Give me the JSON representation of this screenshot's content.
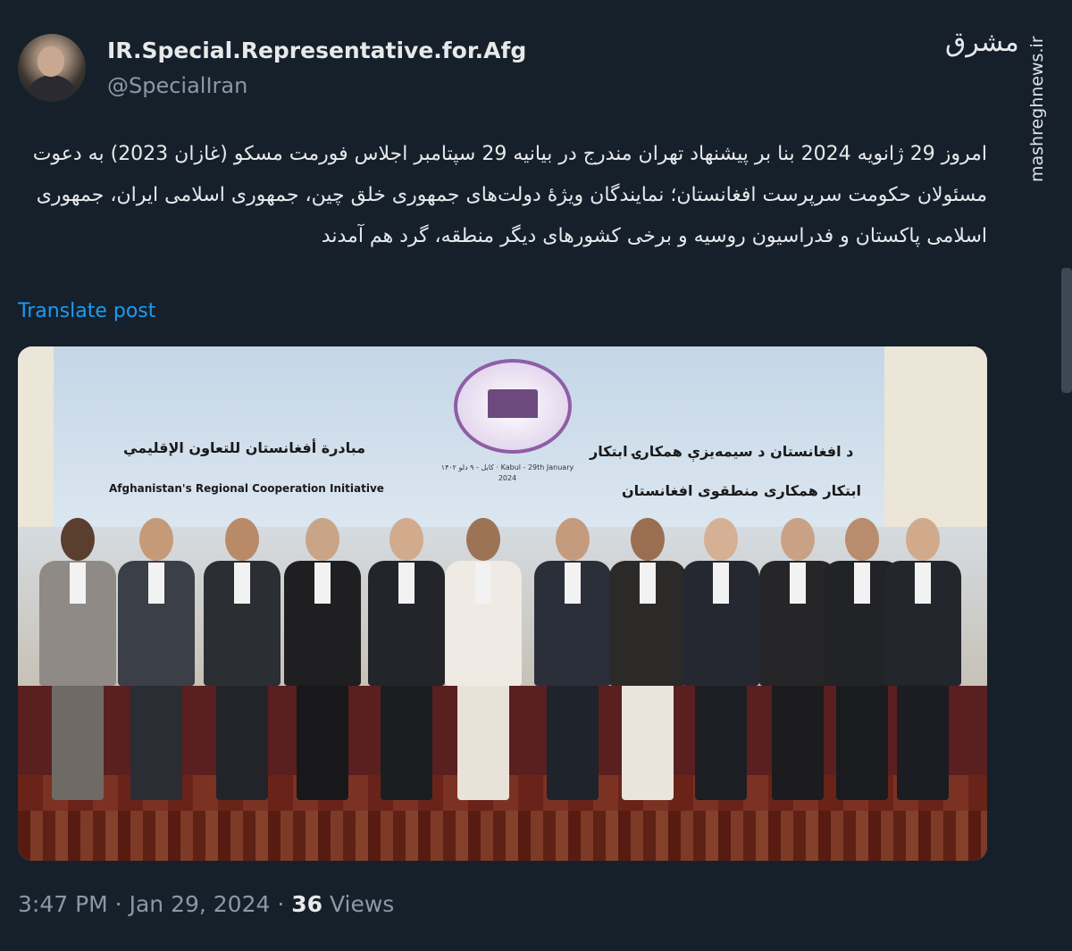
{
  "author": {
    "display_name": "IR.Special.Representative.for.Afg",
    "handle": "@SpecialIran"
  },
  "watermark": {
    "logo_text": "مشرق",
    "url": "mashreghnews.ir"
  },
  "tweet": {
    "text": "امروز 29 ژانویه 2024 بنا بر پیشنهاد تهران مندرج در بیانیه 29 سپتامبر اجلاس فورمت مسکو (غازان 2023) به دعوت مسئولان حکومت سرپرست افغانستان؛ نمایندگان ویژهٔ دولت‌های جمهوری خلق چین، جمهوری اسلامی ایران، جمهوری اسلامی پاکستان و فدراسیون روسیه و برخی کشورهای دیگر منطقه، گرد هم آمدند",
    "translate_label": "Translate post"
  },
  "photo": {
    "banner_arabic": "مبادرة أفغانستان للتعاون الإقليمي",
    "banner_english": "Afghanistan's Regional Cooperation Initiative",
    "banner_pashto": "د افغانستان د سیمه‌یزې همکارۍ ابتکار",
    "banner_dari": "ابتکار همکاری منطقوی افغانستان",
    "banner_center": "کابل - ۹ دلو ۱۴۰۲ · Kabul - 29th January 2024"
  },
  "meta": {
    "time": "3:47 PM",
    "separator1": " · ",
    "date": "Jan 29, 2024",
    "separator2": " · ",
    "views_count": "36",
    "views_label": " Views"
  },
  "colors": {
    "background": "#15202b",
    "primary_text": "#e7e9ea",
    "secondary_text": "#8b98a5",
    "link": "#1d9bf0"
  }
}
